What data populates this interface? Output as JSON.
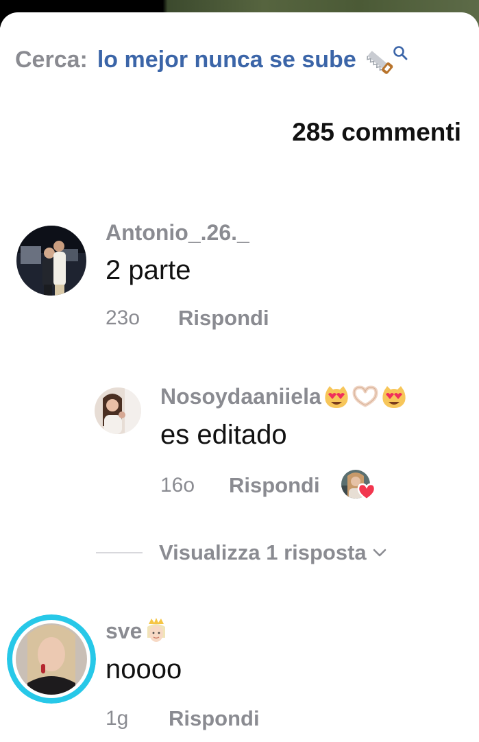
{
  "search": {
    "prefix": "Cerca:",
    "query": "lo mejor nunca se sube",
    "query_emoji_icon": "saw-icon"
  },
  "comments_count": "285 commenti",
  "comments": [
    {
      "username": "Antonio_.26._",
      "text": "2 parte",
      "time": "23o",
      "reply_label": "Rispondi"
    },
    {
      "username": "Nosoydaaniiela",
      "username_emojis": [
        "heart-eyes-cat-icon",
        "heart-hands-icon",
        "heart-eyes-cat-icon"
      ],
      "text": "es editado",
      "time": "16o",
      "reply_label": "Rispondi",
      "liked_by_creator": true
    },
    {
      "username": "sve",
      "username_emojis": [
        "princess-icon"
      ],
      "text": "noooo",
      "time": "1g",
      "reply_label": "Rispondi",
      "has_story_ring": true
    }
  ],
  "view_replies": {
    "label": "Visualizza 1 risposta"
  },
  "colors": {
    "muted_text": "#8a8b91",
    "query_blue": "#3b65a8",
    "story_ring": "#27c8e8",
    "like_red": "#f2364e"
  }
}
